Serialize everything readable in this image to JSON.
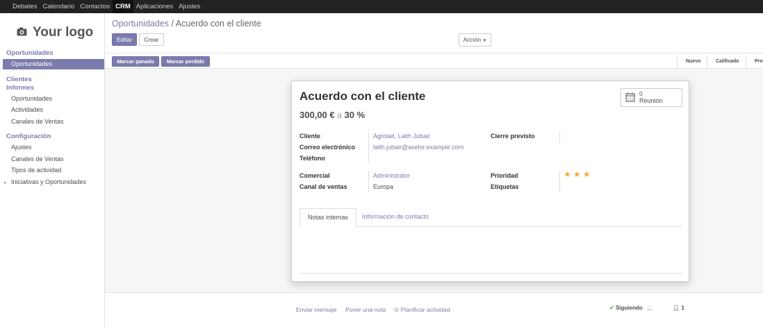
{
  "topbar": {
    "items": [
      "Debates",
      "Calendario",
      "Contactos",
      "CRM",
      "Aplicaciones",
      "Ajustes"
    ],
    "active": "CRM"
  },
  "sidebar": {
    "logo": "Your logo",
    "logo_icon": "camera-icon",
    "oportunidades_head": "Oportunidades",
    "oportunidades_item": "Oportunidades",
    "clientes_head": "Clientes",
    "informes_head": "Informes",
    "informes_items": [
      "Oportunidades",
      "Actividades",
      "Canales de Ventas"
    ],
    "config_head": "Configuración",
    "config_items": [
      "Ajustes",
      "Canales de Ventas",
      "Tipos de actividad"
    ],
    "iniciativas": "Iniciativas y Oportunidades"
  },
  "control": {
    "breadcrumb_parent": "Oportunidades",
    "breadcrumb_sep": "/",
    "breadcrumb_current": "Acuerdo con el cliente",
    "edit": "Editar",
    "create": "Crear",
    "action": "Acción",
    "mark_won": "Marcar ganado",
    "mark_lost": "Marcar perdido",
    "stages": [
      "Nuevo",
      "Calificado",
      "Pro"
    ]
  },
  "record": {
    "title": "Acuerdo con el cliente",
    "amount": "300,00 €",
    "amount_sep": "a",
    "probability": "30 %",
    "meeting_count": "0",
    "meeting_label": "Reunion",
    "meeting_icon": "calendar-icon",
    "labels": {
      "cliente": "Cliente",
      "email": "Correo electrónico",
      "telefono": "Teléfono",
      "cierre": "Cierre previsto",
      "comercial": "Comercial",
      "canal": "Canal de ventas",
      "prioridad": "Prioridad",
      "etiquetas": "Etiquetas"
    },
    "values": {
      "cliente": "Agrolait, Laith Jubair",
      "email": "laith.jubair@axelor.example.com",
      "comercial": "Administrator",
      "canal": "Europa"
    },
    "priority_stars": 3,
    "priority_max": 3,
    "tabs": [
      "Notas internas",
      "Información de contacto"
    ]
  },
  "chatter": {
    "send_message": "Enviar mensaje",
    "log_note": "Poner una nota",
    "schedule": "Planificar actividad",
    "following": "Siguiendo",
    "followers": "1"
  }
}
